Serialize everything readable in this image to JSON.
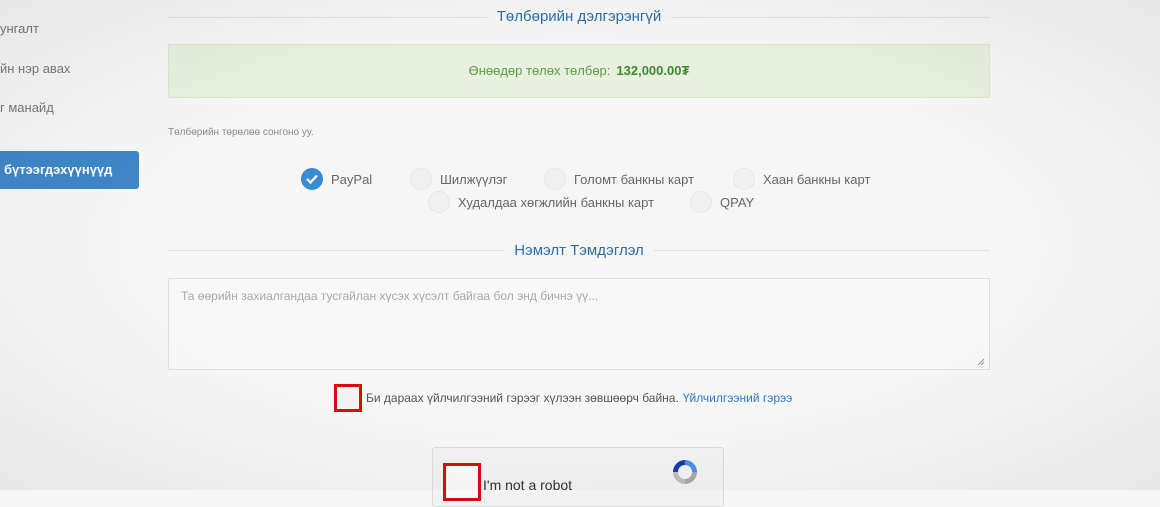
{
  "sidebar": {
    "items": [
      {
        "label": "унгалт"
      },
      {
        "label": "йн нэр авах"
      },
      {
        "label": "г манайд"
      }
    ],
    "active_label": "бүтээгдэхүүнүүд"
  },
  "payment": {
    "section_title": "Төлбөрийн дэлгэрэнгүй",
    "due_label": "Өнөөдөр төлөх төлбөр:",
    "due_amount": "132,000.00₮",
    "choose_hint": "Төлбөрийн төрөлөө сонгоно уу.",
    "methods": [
      {
        "label": "PayPal",
        "selected": true
      },
      {
        "label": "Шилжүүлэг",
        "selected": false
      },
      {
        "label": "Голомт банкны карт",
        "selected": false
      },
      {
        "label": "Хаан банкны карт",
        "selected": false
      },
      {
        "label": "Худалдаа хөгжлийн банкны карт",
        "selected": false
      },
      {
        "label": "QPAY",
        "selected": false
      }
    ]
  },
  "notes": {
    "section_title": "Нэмэлт Тэмдэглэл",
    "placeholder": "Та өөрийн захиалгандаа тусгайлан хүсэх хүсэлт байгаа бол энд бичнэ үү..."
  },
  "terms": {
    "text": "Би дараах үйлчилгээний гэрээг хүлээн зөвшөөрч байна.",
    "link": "Үйлчилгээний гэрээ"
  },
  "captcha": {
    "label": "I'm not a robot"
  },
  "colors": {
    "accent": "#3a8bd1",
    "title_blue": "#2b6ea7",
    "alert_bg": "#e8f1e0",
    "alert_text": "#5a9e44",
    "highlight_red": "#d20f0f"
  }
}
